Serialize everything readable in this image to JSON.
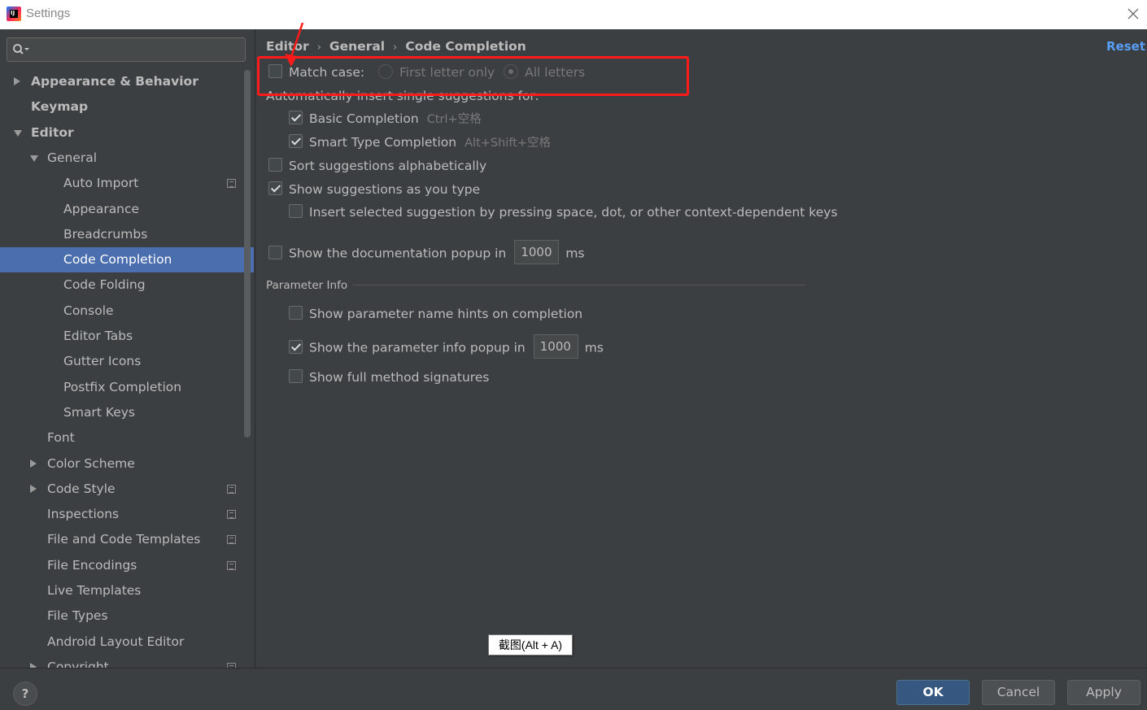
{
  "window": {
    "title": "Settings",
    "app_icon_text": "IJ"
  },
  "search": {
    "placeholder": ""
  },
  "sidebar": {
    "items": [
      {
        "label": "Appearance & Behavior",
        "level": 0,
        "expander": "collapsed",
        "bold": true
      },
      {
        "label": "Keymap",
        "level": 0,
        "expander": "none",
        "bold": true
      },
      {
        "label": "Editor",
        "level": 0,
        "expander": "expanded",
        "bold": true
      },
      {
        "label": "General",
        "level": 1,
        "expander": "expanded"
      },
      {
        "label": "Auto Import",
        "level": 2,
        "expander": "none",
        "copy_icon": true
      },
      {
        "label": "Appearance",
        "level": 2,
        "expander": "none"
      },
      {
        "label": "Breadcrumbs",
        "level": 2,
        "expander": "none"
      },
      {
        "label": "Code Completion",
        "level": 2,
        "expander": "none",
        "selected": true
      },
      {
        "label": "Code Folding",
        "level": 2,
        "expander": "none"
      },
      {
        "label": "Console",
        "level": 2,
        "expander": "none"
      },
      {
        "label": "Editor Tabs",
        "level": 2,
        "expander": "none"
      },
      {
        "label": "Gutter Icons",
        "level": 2,
        "expander": "none"
      },
      {
        "label": "Postfix Completion",
        "level": 2,
        "expander": "none"
      },
      {
        "label": "Smart Keys",
        "level": 2,
        "expander": "none"
      },
      {
        "label": "Font",
        "level": 1,
        "expander": "none"
      },
      {
        "label": "Color Scheme",
        "level": 1,
        "expander": "collapsed"
      },
      {
        "label": "Code Style",
        "level": 1,
        "expander": "collapsed",
        "copy_icon": true
      },
      {
        "label": "Inspections",
        "level": 1,
        "expander": "none",
        "copy_icon": true
      },
      {
        "label": "File and Code Templates",
        "level": 1,
        "expander": "none",
        "copy_icon": true
      },
      {
        "label": "File Encodings",
        "level": 1,
        "expander": "none",
        "copy_icon": true
      },
      {
        "label": "Live Templates",
        "level": 1,
        "expander": "none"
      },
      {
        "label": "File Types",
        "level": 1,
        "expander": "none"
      },
      {
        "label": "Android Layout Editor",
        "level": 1,
        "expander": "none"
      },
      {
        "label": "Copyright",
        "level": 1,
        "expander": "collapsed",
        "copy_icon": true
      }
    ]
  },
  "breadcrumb": {
    "items": [
      "Editor",
      "General",
      "Code Completion"
    ],
    "separator": "›"
  },
  "reset_label": "Reset",
  "options": {
    "match_case": {
      "label": "Match case:",
      "checked": false
    },
    "first_letter_only": {
      "label": "First letter only",
      "selected": false
    },
    "all_letters": {
      "label": "All letters",
      "selected": true
    },
    "auto_insert_heading": "Automatically insert single suggestions for:",
    "basic_completion": {
      "label": "Basic Completion",
      "shortcut": "Ctrl+空格",
      "checked": true
    },
    "smart_type_completion": {
      "label": "Smart Type Completion",
      "shortcut": "Alt+Shift+空格",
      "checked": true
    },
    "sort_alphabetically": {
      "label": "Sort suggestions alphabetically",
      "checked": false
    },
    "show_as_you_type": {
      "label": "Show suggestions as you type",
      "checked": true
    },
    "insert_selected": {
      "label": "Insert selected suggestion by pressing space, dot, or other context-dependent keys",
      "checked": false
    },
    "doc_popup": {
      "label": "Show the documentation popup in",
      "value": "1000",
      "unit": "ms",
      "checked": false
    }
  },
  "parameter_info": {
    "title": "Parameter Info",
    "name_hints": {
      "label": "Show parameter name hints on completion",
      "checked": false
    },
    "info_popup": {
      "label": "Show the parameter info popup in",
      "value": "1000",
      "unit": "ms",
      "checked": true
    },
    "full_signatures": {
      "label": "Show full method signatures",
      "checked": false
    }
  },
  "tooltip": {
    "text": "截图(Alt + A)"
  },
  "buttons": {
    "help": "?",
    "ok": "OK",
    "cancel": "Cancel",
    "apply": "Apply"
  },
  "colors": {
    "selection": "#4b6eaf",
    "highlight": "#ff1a1a",
    "link": "#589df6",
    "ok_button": "#365880"
  }
}
